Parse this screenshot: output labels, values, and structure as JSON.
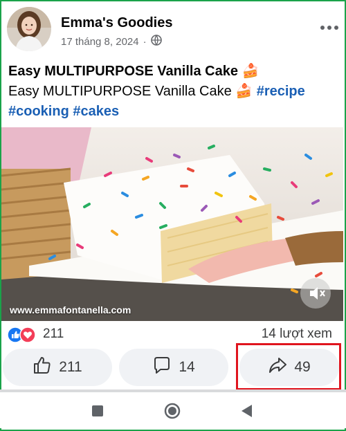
{
  "post": {
    "author": "Emma's Goodies",
    "date": "17 tháng 8, 2024",
    "separator": "·",
    "title": "Easy MULTIPURPOSE Vanilla Cake 🍰",
    "body_text": "Easy MULTIPURPOSE Vanilla Cake 🍰 ",
    "hashtags": [
      "#recipe",
      "#cooking",
      "#cakes"
    ],
    "image_watermark": "www.emmafontanella.com"
  },
  "stats": {
    "reaction_count": "211",
    "views": "14 lượt xem"
  },
  "actions": {
    "like_count": "211",
    "comment_count": "14",
    "share_count": "49"
  },
  "icons": {
    "more": "more-options-icon",
    "privacy": "globe-icon",
    "like": "thumbs-up-icon",
    "comment": "comment-bubble-icon",
    "share": "share-arrow-icon",
    "mute": "mute-icon",
    "nav": [
      "square-recents-icon",
      "circle-home-icon",
      "triangle-back-icon"
    ]
  },
  "colors": {
    "frame_border": "#1aa34a",
    "highlight_border": "#e0141e",
    "hashtag": "#1a5fb4",
    "like_blue": "#1877f2",
    "love_red": "#f33e58"
  }
}
